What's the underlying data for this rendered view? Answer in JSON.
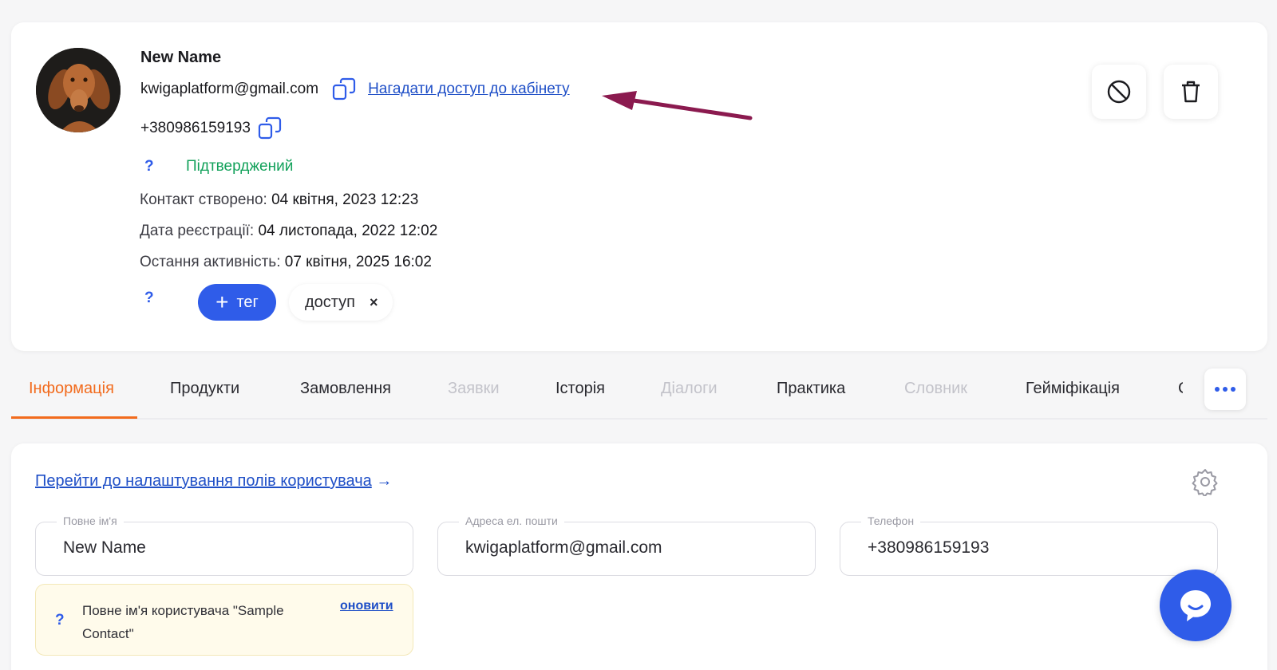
{
  "profile": {
    "name": "New Name",
    "email": "kwigaplatform@gmail.com",
    "remind_link": "Нагадати доступ до кабінету",
    "phone": "+380986159193",
    "status_help": "?",
    "status": "Підтверджений",
    "meta": [
      {
        "label": "Контакт створено:",
        "value": "04 квітня, 2023 12:23"
      },
      {
        "label": "Дата реєстрації:",
        "value": "04 листопада, 2022 12:02"
      },
      {
        "label": "Остання активність:",
        "value": "07 квітня, 2025 16:02"
      }
    ],
    "tags_help": "?",
    "add_tag_plus": "+",
    "add_tag_label": "тег",
    "tags": [
      {
        "label": "доступ",
        "remove": "×"
      }
    ]
  },
  "tabs": [
    {
      "label": "Інформація",
      "state": "active"
    },
    {
      "label": "Продукти",
      "state": "normal"
    },
    {
      "label": "Замовлення",
      "state": "normal"
    },
    {
      "label": "Заявки",
      "state": "disabled"
    },
    {
      "label": "Історія",
      "state": "normal"
    },
    {
      "label": "Діалоги",
      "state": "disabled"
    },
    {
      "label": "Практика",
      "state": "normal"
    },
    {
      "label": "Словник",
      "state": "disabled"
    },
    {
      "label": "Гейміфікація",
      "state": "normal"
    }
  ],
  "tab_partial": "С",
  "info": {
    "settings_link": "Перейти до налаштування полів користувача",
    "settings_arrow": "→",
    "fields": {
      "name": {
        "label": "Повне ім'я",
        "value": "New Name"
      },
      "email": {
        "label": "Адреса ел. пошти",
        "value": "kwigaplatform@gmail.com"
      },
      "phone": {
        "label": "Телефон",
        "value": "+380986159193"
      }
    },
    "notice": {
      "help": "?",
      "text": "Повне ім'я користувача \"Sample Contact\"",
      "action": "оновити"
    }
  },
  "colors": {
    "accent_blue": "#2f5ce9",
    "active_tab": "#f26b1d",
    "confirmed": "#12a15a",
    "annotation_arrow": "#8b1a4f"
  }
}
